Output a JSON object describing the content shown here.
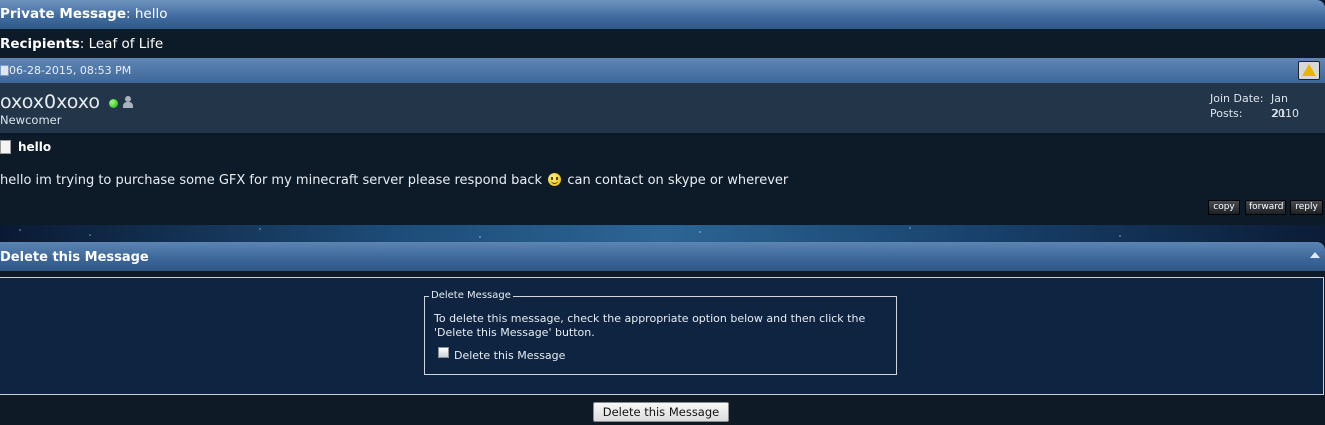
{
  "header": {
    "label": "Private Message",
    "separator": ": ",
    "subject": "hello"
  },
  "recipients": {
    "label": "Recipients",
    "separator": ": ",
    "name": "Leaf of Life"
  },
  "post": {
    "date": "06-28-2015, 08:53 PM",
    "username": "oxox0xoxo",
    "status": "online",
    "user_title": "Newcomer",
    "join_date_label": "Join Date:",
    "join_date": "Jan 2010",
    "posts_label": "Posts:",
    "posts": "21",
    "message_title": "hello",
    "message_text_before": "hello im trying to purchase some GFX for my minecraft server please respond back",
    "message_text_after": "can contact on skype or wherever",
    "buttons": {
      "copy": "copy",
      "forward": "forward",
      "reply": "reply"
    }
  },
  "delete_section": {
    "title": "Delete this Message",
    "fieldset_legend": "Delete Message",
    "instructions": "To delete this message, check the appropriate option below and then click the 'Delete this Message' button.",
    "checkbox_label": "Delete this Message",
    "checkbox_checked": false,
    "submit_label": "Delete this Message"
  },
  "icons": {
    "online": "online-status-icon",
    "user": "user-profile-icon",
    "report": "report-warning-icon",
    "post": "post-icon",
    "message": "document-icon",
    "smiley": "smiley-icon",
    "collapse": "collapse-icon"
  }
}
